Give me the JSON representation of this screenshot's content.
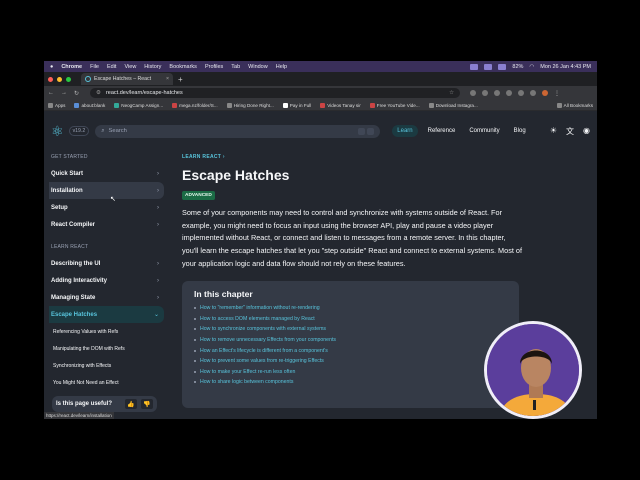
{
  "menubar": {
    "app": "Chrome",
    "menus": [
      "File",
      "Edit",
      "View",
      "History",
      "Bookmarks",
      "Profiles",
      "Tab",
      "Window",
      "Help"
    ],
    "battery": "82%",
    "clock": "Mon 26 Jan  4:43 PM"
  },
  "tab": {
    "title": "Escape Hatches – React",
    "close": "×",
    "new_tab": "+"
  },
  "toolbar": {
    "back": "←",
    "forward": "→",
    "reload": "↻",
    "url": "react.dev/learn/escape-hatches"
  },
  "bookmarks": {
    "items": [
      "Apps",
      "about:blank",
      "NeogCamp Assign...",
      "mega.nz/folder/S...",
      "Hiring Done Right...",
      "Pay in Full",
      "Videos Tanay sir",
      "Free YouTube Vide...",
      "Download Instagra..."
    ],
    "all": "All Bookmarks"
  },
  "header": {
    "logo": "⚛",
    "version": "v19.2",
    "search_placeholder": "Search",
    "nav": {
      "learn": "Learn",
      "reference": "Reference",
      "community": "Community",
      "blog": "Blog"
    }
  },
  "sidebar": {
    "section_start": "GET STARTED",
    "start_items": [
      "Quick Start",
      "Installation",
      "Setup",
      "React Compiler"
    ],
    "section_learn": "LEARN REACT",
    "learn_items": [
      "Describing the UI",
      "Adding Interactivity",
      "Managing State",
      "Escape Hatches"
    ],
    "sub_items": [
      "Referencing Values with Refs",
      "Manipulating the DOM with Refs",
      "Synchronizing with Effects",
      "You Might Not Need an Effect"
    ],
    "chevron_right": "›",
    "chevron_down": "⌄",
    "feedback": {
      "label": "Is this page useful?",
      "up": "👍",
      "down": "👎"
    },
    "status_url": "https://react.dev/learn/installation"
  },
  "main": {
    "breadcrumb": "LEARN REACT  ›",
    "title": "Escape Hatches",
    "badge": "ADVANCED",
    "intro": "Some of your components may need to control and synchronize with systems outside of React. For example, you might need to focus an input using the browser API, play and pause a video player implemented without React, or connect and listen to messages from a remote server. In this chapter, you'll learn the escape hatches that let you \"step outside\" React and connect to external systems. Most of your application logic and data flow should not rely on these features.",
    "chapter_title": "In this chapter",
    "chapter_links": [
      "How to \"remember\" information without re-rendering",
      "How to access DOM elements managed by React",
      "How to synchronize components with external systems",
      "How to remove unnecessary Effects from your components",
      "How an Effect's lifecycle is different from a component's",
      "How to prevent some values from re-triggering Effects",
      "How to make your Effect re-run less often",
      "How to share logic between components"
    ]
  },
  "colors": {
    "accent": "#58c4dc",
    "bg": "#23272f",
    "panel": "#343a46",
    "badge": "#1b6b45"
  }
}
